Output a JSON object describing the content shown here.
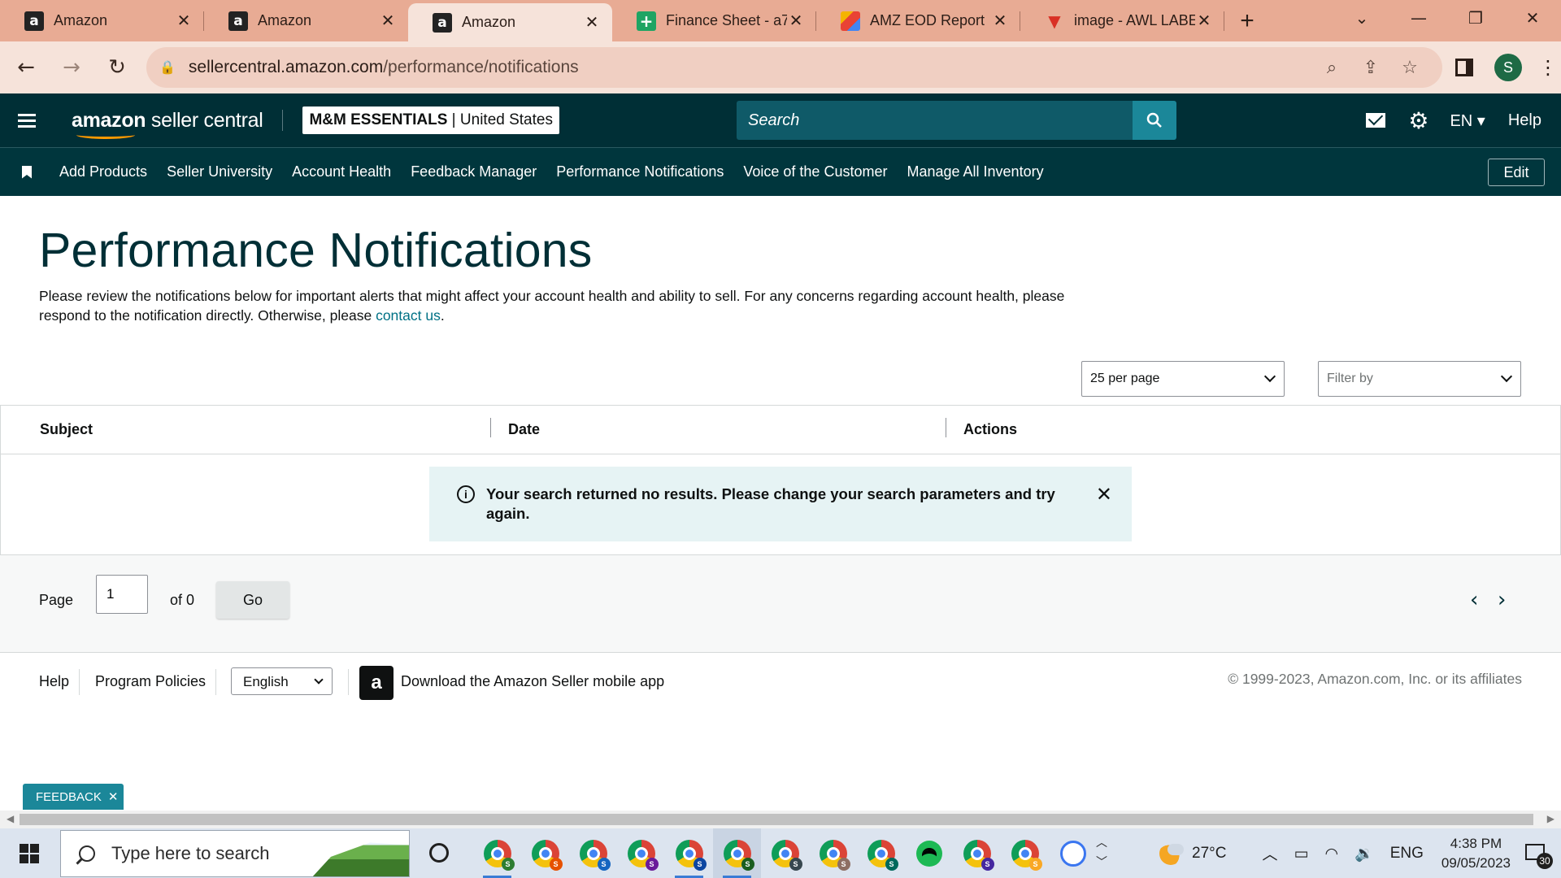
{
  "browser": {
    "tabs": [
      {
        "title": "Amazon",
        "icon": "amazon-favicon",
        "active": false
      },
      {
        "title": "Amazon",
        "icon": "amazon-favicon",
        "active": false
      },
      {
        "title": "Amazon",
        "icon": "amazon-favicon",
        "active": true
      },
      {
        "title": "Finance Sheet - a71",
        "icon": "google-sheets-favicon",
        "active": false
      },
      {
        "title": "AMZ EOD Report",
        "icon": "report-favicon",
        "active": false
      },
      {
        "title": "image - AWL LABEL",
        "icon": "image-favicon",
        "active": false
      }
    ],
    "url_host": "sellercentral.amazon.com",
    "url_path": "/performance/notifications",
    "profile_initial": "S",
    "accent": "#e8ab94"
  },
  "header": {
    "logo_brand": "amazon",
    "logo_product": " seller central",
    "store_name": "M&M ESSENTIALS",
    "store_region": "United States",
    "search_placeholder": "Search",
    "language": "EN",
    "help": "Help",
    "bg_color": "#002f36"
  },
  "nav": {
    "items": [
      "Add Products",
      "Seller University",
      "Account Health",
      "Feedback Manager",
      "Performance Notifications",
      "Voice of the Customer",
      "Manage All Inventory"
    ],
    "edit": "Edit"
  },
  "main": {
    "title": "Performance Notifications",
    "intro_text": "Please review the notifications below for important alerts that might affect your account health and ability to sell. For any concerns regarding account health, please respond to the notification directly. Otherwise, please ",
    "intro_link": "contact us",
    "intro_end": ".",
    "per_page": "25 per page",
    "filter_placeholder": "Filter by",
    "columns": [
      "Subject",
      "Date",
      "Actions"
    ],
    "alert_message": "Your search returned no results. Please change your search parameters and try again.",
    "pager": {
      "page_label": "Page",
      "page_value": "1",
      "of_label": "of 0",
      "go": "Go"
    }
  },
  "footer": {
    "help": "Help",
    "policies": "Program Policies",
    "language": "English",
    "app_text": "Download the Amazon Seller mobile app",
    "copyright": "© 1999-2023, Amazon.com, Inc. or its affiliates",
    "feedback": "FEEDBACK"
  },
  "taskbar": {
    "search_placeholder": "Type here to search",
    "temperature": "27°C",
    "lang": "ENG",
    "time": "4:38 PM",
    "date": "09/05/2023",
    "notifications": "30"
  }
}
